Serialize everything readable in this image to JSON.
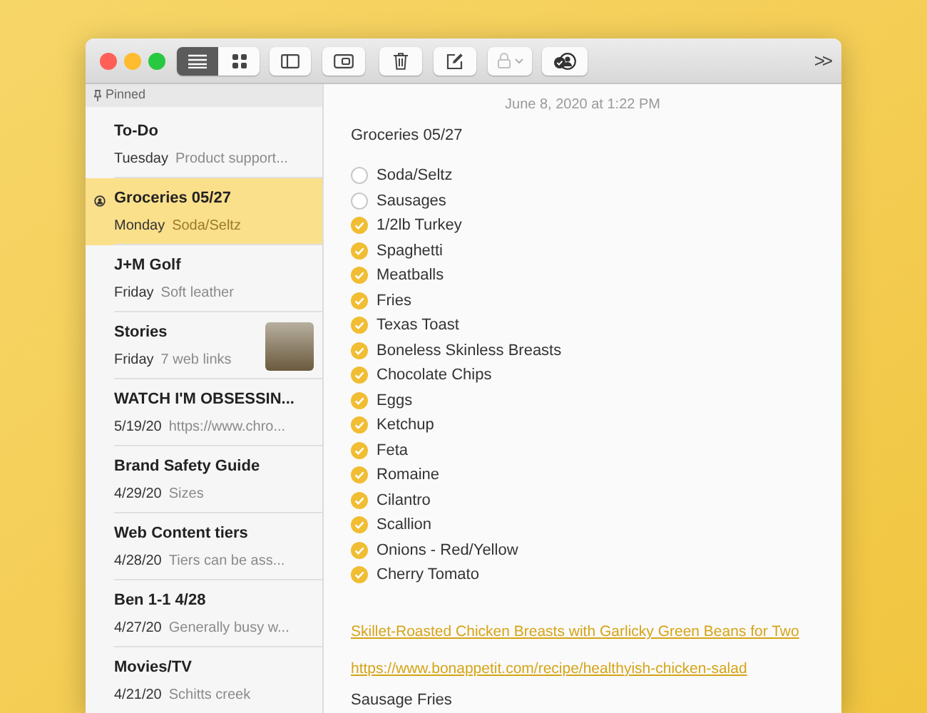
{
  "toolbar": {
    "view_modes": [
      {
        "kind": "list",
        "selected": true
      },
      {
        "kind": "gallery",
        "selected": false
      }
    ],
    "lock": {
      "disabled": true
    },
    "overflow": ">>"
  },
  "sidebar": {
    "section": "Pinned",
    "notes": [
      {
        "title": "To-Do",
        "date": "Tuesday",
        "preview": "Product support...",
        "selected": false,
        "shared": false,
        "has_photo": false
      },
      {
        "title": "Groceries 05/27",
        "date": "Monday",
        "preview": "Soda/Seltz",
        "selected": true,
        "shared": true,
        "has_photo": false
      },
      {
        "title": "J+M Golf",
        "date": "Friday",
        "preview": "Soft leather",
        "selected": false,
        "shared": false,
        "has_photo": false
      },
      {
        "title": "Stories",
        "date": "Friday",
        "preview": "7 web links",
        "selected": false,
        "shared": false,
        "has_photo": true
      },
      {
        "title": "WATCH I'M OBSESSIN...",
        "date": "5/19/20",
        "preview": "https://www.chro...",
        "selected": false,
        "shared": false,
        "has_photo": false
      },
      {
        "title": "Brand Safety Guide",
        "date": "4/29/20",
        "preview": "Sizes",
        "selected": false,
        "shared": false,
        "has_photo": false
      },
      {
        "title": "Web Content tiers",
        "date": "4/28/20",
        "preview": "Tiers can be ass...",
        "selected": false,
        "shared": false,
        "has_photo": false
      },
      {
        "title": "Ben 1-1 4/28",
        "date": "4/27/20",
        "preview": "Generally busy w...",
        "selected": false,
        "shared": false,
        "has_photo": false
      },
      {
        "title": "Movies/TV",
        "date": "4/21/20",
        "preview": "Schitts creek",
        "selected": false,
        "shared": false,
        "has_photo": false
      }
    ]
  },
  "note": {
    "timestamp": "June 8, 2020 at 1:22 PM",
    "title": "Groceries 05/27",
    "checklist": [
      {
        "text": "Soda/Seltz",
        "checked": false
      },
      {
        "text": "Sausages",
        "checked": false
      },
      {
        "text": "1/2lb Turkey",
        "checked": true
      },
      {
        "text": "Spaghetti",
        "checked": true
      },
      {
        "text": "Meatballs",
        "checked": true
      },
      {
        "text": "Fries",
        "checked": true
      },
      {
        "text": "Texas Toast",
        "checked": true
      },
      {
        "text": "Boneless Skinless Breasts",
        "checked": true
      },
      {
        "text": "Chocolate Chips",
        "checked": true
      },
      {
        "text": "Eggs",
        "checked": true
      },
      {
        "text": "Ketchup",
        "checked": true
      },
      {
        "text": "Feta",
        "checked": true
      },
      {
        "text": "Romaine",
        "checked": true
      },
      {
        "text": "Cilantro",
        "checked": true
      },
      {
        "text": "Scallion",
        "checked": true
      },
      {
        "text": "Onions - Red/Yellow",
        "checked": true
      },
      {
        "text": "Cherry Tomato",
        "checked": true
      }
    ],
    "links": [
      "Skillet-Roasted Chicken Breasts with Garlicky Green Beans for Two",
      "https://www.bonappetit.com/recipe/healthyish-chicken-salad"
    ],
    "trailing_text": "Sausage Fries"
  }
}
